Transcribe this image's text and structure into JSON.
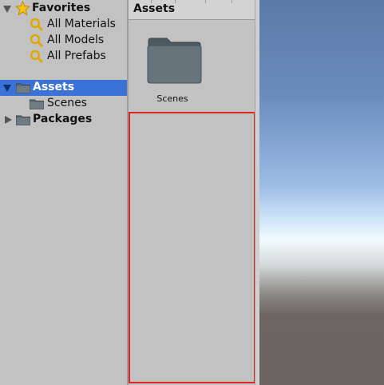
{
  "tree": {
    "favorites": {
      "label": "Favorites",
      "items": [
        {
          "label": "All Materials"
        },
        {
          "label": "All Models"
        },
        {
          "label": "All Prefabs"
        }
      ]
    },
    "assets": {
      "label": "Assets",
      "children": [
        {
          "label": "Scenes"
        }
      ]
    },
    "packages": {
      "label": "Packages"
    }
  },
  "grid": {
    "header": "Assets",
    "items": [
      {
        "label": "Scenes"
      }
    ]
  },
  "colors": {
    "selection": "#3a72d8",
    "drop_highlight": "#e02424",
    "panel_bg": "#c2c2c2"
  },
  "icons": {
    "favorites": "star-icon",
    "saved_search": "search-icon",
    "folder": "folder-icon",
    "expanded": "triangle-down-icon",
    "collapsed": "triangle-right-icon"
  }
}
